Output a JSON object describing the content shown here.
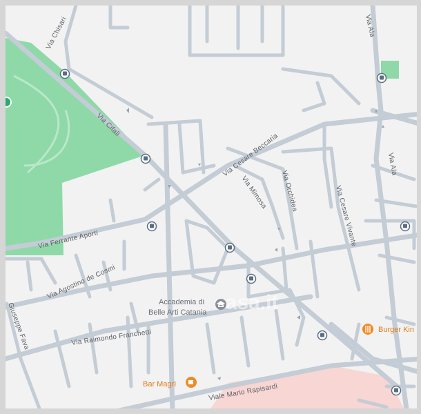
{
  "map": {
    "streets": {
      "via_chisari": "Via Chisari",
      "via_cifali": "Via Cifali",
      "via_cesare_beccaria": "Via Cesare Beccaria",
      "via_mimosa": "Via Mimosa",
      "via_orchidea": "Via Orchidea",
      "via_ala": "Via Ala",
      "via_cesare_vivante": "Via Cesare Vivante",
      "via_ferrante_aporti": "Via Ferrante Aporti",
      "via_agostino_de_cosmi": "Via Agostino de Cosmi",
      "via_giuseppe_fava": "Giuseppe Fava",
      "via_raimondo_franchetti": "Via Raimondo Franchetti",
      "viale_mario_rapisardi": "Viale Mario Rapisardi"
    },
    "pois": {
      "accademia_line1": "Accademia di",
      "accademia_line2": "Belle Arti Catania",
      "burger_king": "Burger Kin",
      "bar_magri": "Bar Magrì"
    },
    "watermark": "casa.it",
    "colors": {
      "background": "#f2f2f2",
      "road": "#c4ccd5",
      "park": "#8fd9a8",
      "pink_area": "#f7d6d4",
      "poi_orange": "#f08a24",
      "bus_icon": "#5a6e82"
    }
  }
}
